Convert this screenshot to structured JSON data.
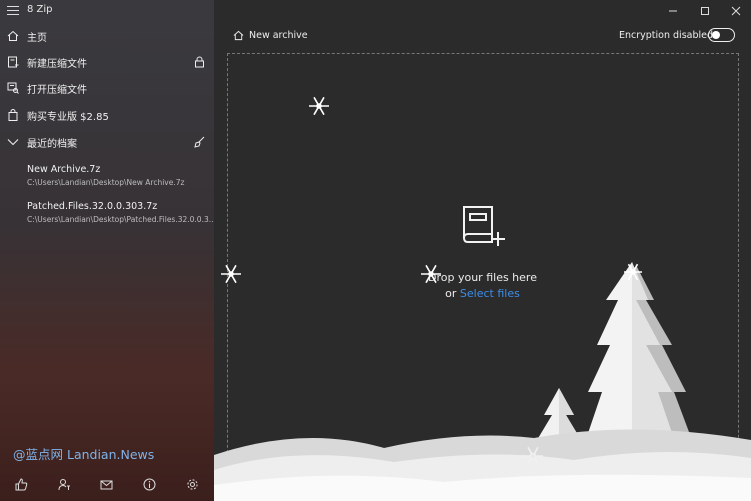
{
  "app": {
    "title": "8 Zip"
  },
  "sidebar": {
    "items": [
      {
        "label": "主页",
        "icon": "home-icon"
      },
      {
        "label": "新建压缩文件",
        "icon": "new-archive-icon",
        "right_icon": "lock-icon"
      },
      {
        "label": "打开压缩文件",
        "icon": "open-archive-icon"
      },
      {
        "label": "购买专业版 $2.85",
        "icon": "shopping-bag-icon"
      },
      {
        "label": "最近的档案",
        "icon": "chevron-down-icon",
        "right_icon": "broom-icon"
      }
    ],
    "recent": [
      {
        "name": "New Archive.7z",
        "path": "C:\\Users\\Landian\\Desktop\\New Archive.7z"
      },
      {
        "name": "Patched.Files.32.0.0.303.7z",
        "path": "C:\\Users\\Landian\\Desktop\\Patched.Files.32.0.0.3..."
      }
    ],
    "watermark": "@蓝点网 Landian.News",
    "bottom_icons": [
      "thumbs-up-icon",
      "account-icon",
      "mail-icon",
      "info-icon",
      "settings-icon"
    ]
  },
  "header": {
    "breadcrumb": "New archive",
    "encryption_label": "Encryption disabled",
    "encryption_enabled": false
  },
  "dropzone": {
    "line1": "Drop your files here",
    "or_text": "or",
    "select_link": "Select files"
  },
  "colors": {
    "accent": "#3d8ee8",
    "background": "#2b2b2b"
  }
}
